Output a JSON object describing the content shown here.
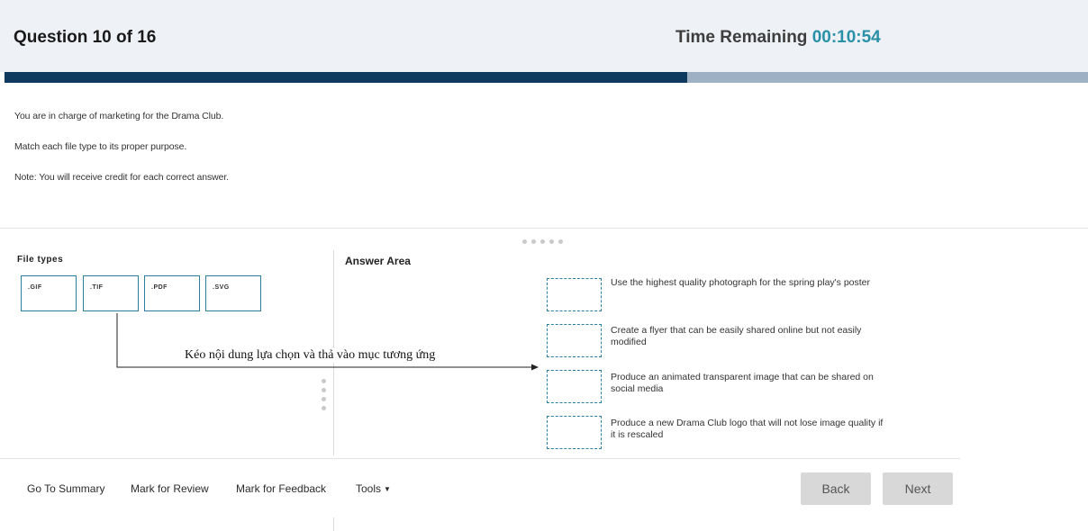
{
  "header": {
    "question": "Question 10 of 16",
    "time_label": "Time Remaining",
    "time_value": "00:10:54",
    "progress_fraction": 0.63
  },
  "instructions": {
    "line1": "You are in charge of marketing for the Drama Club.",
    "line2": "Match each file type to its proper purpose.",
    "line3": "Note: You will receive credit for each correct answer."
  },
  "source": {
    "label": "File types",
    "items": [
      {
        "label": ".GIF"
      },
      {
        "label": ".TIF"
      },
      {
        "label": ".PDF"
      },
      {
        "label": ".SVG"
      }
    ]
  },
  "answer": {
    "title": "Answer Area",
    "purposes": [
      "Use the highest quality photograph for the spring play's poster",
      "Create a flyer that can be easily shared online but not easily modified",
      "Produce an animated transparent image that can be shared on social media",
      "Produce a new Drama Club logo that will not lose image quality if it is rescaled"
    ]
  },
  "annotation": "Kéo nội dung lựa chọn và thả vào mục tương ứng",
  "footer": {
    "go_to_summary": "Go To Summary",
    "mark_review": "Mark for Review",
    "mark_feedback": "Mark for Feedback",
    "tools": "Tools",
    "back": "Back",
    "next": "Next"
  }
}
